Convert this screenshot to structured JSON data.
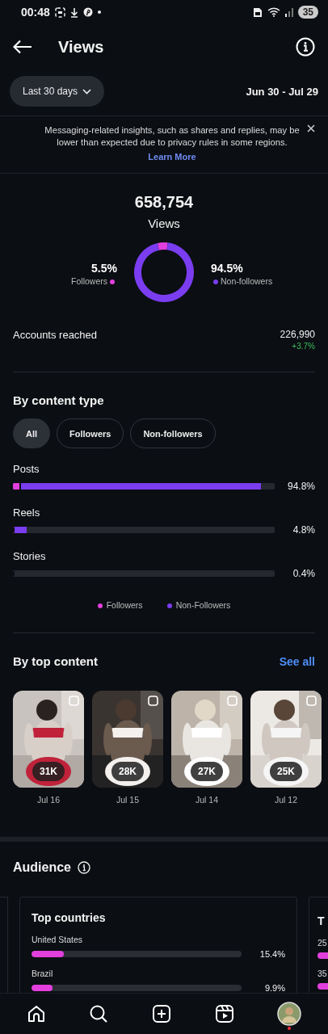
{
  "status_bar": {
    "time": "00:48",
    "battery": "35"
  },
  "header": {
    "title": "Views"
  },
  "date_range": {
    "label": "Last 30 days",
    "range": "Jun 30 - Jul 29"
  },
  "notice": {
    "text": "Messaging-related insights, such as shares and replies, may be lower than expected due to privacy rules in some regions.",
    "link": "Learn More"
  },
  "summary": {
    "total": "658,754",
    "label": "Views",
    "followers": {
      "percent": "5.5%"
    },
    "non_followers": {
      "percent": "94.5%"
    },
    "chart_data": {
      "type": "donut",
      "categories": [
        "Followers",
        "Non-followers"
      ],
      "values": [
        5.5,
        94.5
      ]
    }
  },
  "accounts_reached": {
    "label": "Accounts reached",
    "value": "226,990",
    "change": "+3.7%"
  },
  "content_type": {
    "title": "By content type",
    "filters": [
      {
        "label": "All",
        "selected": true
      },
      {
        "label": "Followers",
        "selected": false
      },
      {
        "label": "Non-followers",
        "selected": false
      }
    ],
    "rows": [
      {
        "label": "Posts",
        "value": "94.8%",
        "segments": [
          {
            "kind": "non_followers",
            "level": 0.948
          },
          {
            "kind": "followers",
            "level": 0.03
          }
        ]
      },
      {
        "label": "Reels",
        "value": "4.8%",
        "segments": [
          {
            "kind": "non_followers",
            "level": 0.052
          },
          {
            "kind": "followers",
            "level": 0.006
          }
        ]
      },
      {
        "label": "Stories",
        "value": "0.4%",
        "segments": [
          {
            "kind": "followers",
            "level": 0.004
          }
        ]
      }
    ],
    "legend": [
      {
        "kind": "followers",
        "label": "Followers"
      },
      {
        "kind": "non_followers",
        "label": "Non-Followers"
      }
    ]
  },
  "top_content": {
    "title": "By top content",
    "see_all": "See all",
    "items": [
      {
        "count": "31K",
        "date": "Jul 16"
      },
      {
        "count": "28K",
        "date": "Jul 15"
      },
      {
        "count": "27K",
        "date": "Jul 14"
      },
      {
        "count": "25K",
        "date": "Jul 12"
      }
    ]
  },
  "audience": {
    "title": "Audience",
    "cards": [
      {
        "title": "Top countries",
        "rows": [
          {
            "label": "United States",
            "value": "15.4%",
            "level": 0.154
          },
          {
            "label": "Brazil",
            "value": "9.9%",
            "level": 0.099
          }
        ]
      },
      {
        "title": "T",
        "rows": [
          {
            "label": "25"
          },
          {
            "label": "35"
          }
        ]
      }
    ]
  },
  "nav": {
    "items": [
      {
        "kind": "home"
      },
      {
        "kind": "search"
      },
      {
        "kind": "create"
      },
      {
        "kind": "reels"
      },
      {
        "kind": "profile"
      }
    ]
  }
}
